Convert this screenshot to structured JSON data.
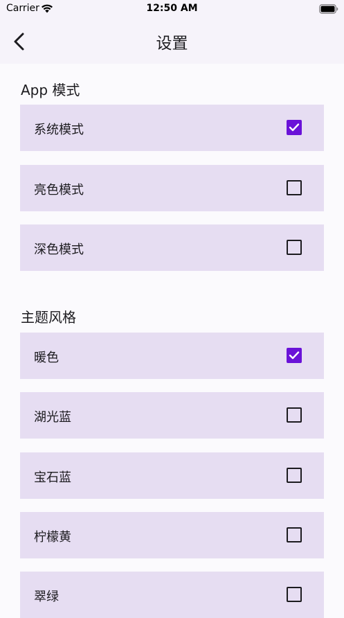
{
  "status_bar": {
    "carrier": "Carrier",
    "time": "12:50 AM",
    "icons": [
      "wifi-icon",
      "battery-icon"
    ]
  },
  "nav": {
    "title": "设置",
    "back_icon": "chevron-left-icon"
  },
  "sections": [
    {
      "title": "App 模式",
      "options": [
        {
          "label": "系统模式",
          "checked": true
        },
        {
          "label": "亮色模式",
          "checked": false
        },
        {
          "label": "深色模式",
          "checked": false
        }
      ]
    },
    {
      "title": "主题风格",
      "options": [
        {
          "label": "暖色",
          "checked": true
        },
        {
          "label": "湖光蓝",
          "checked": false
        },
        {
          "label": "宝石蓝",
          "checked": false
        },
        {
          "label": "柠檬黄",
          "checked": false
        },
        {
          "label": "翠绿",
          "checked": false
        }
      ]
    }
  ],
  "colors": {
    "accent": "#6a12d8",
    "row_background": "#e6ddf2",
    "page_background": "#fbfafd",
    "header_background": "#f6f3fa"
  }
}
